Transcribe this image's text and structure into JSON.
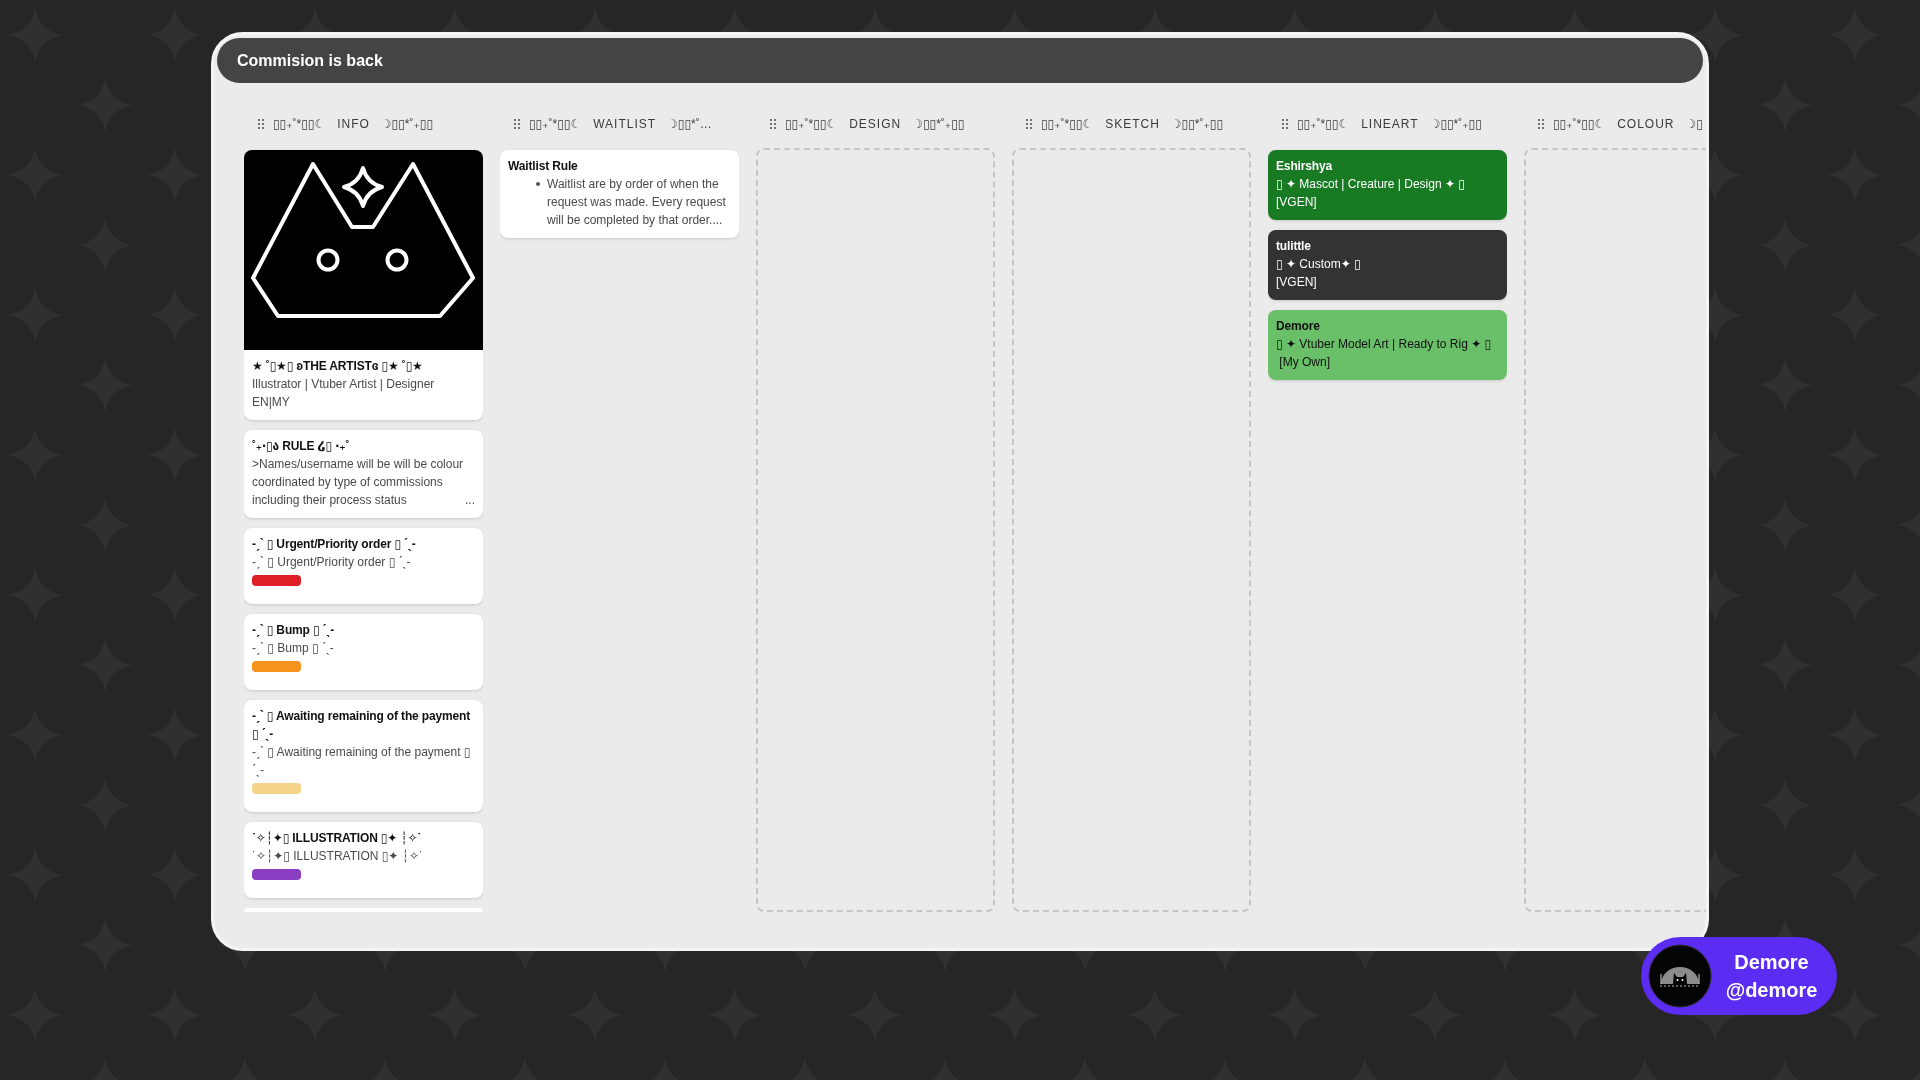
{
  "board": {
    "title": "Commision is back"
  },
  "columns": [
    {
      "deco_left": "▯▯₊˚*▯▯☾",
      "title": "INFO",
      "deco_right": "☽▯▯*˚₊▯▯",
      "cards": [
        {
          "kind": "cover",
          "title": "★ ˚▯★▯ ʚTHE ARTISTɞ ▯★ ˚▯★",
          "lines": [
            "Illustrator | Vtuber Artist | Designer",
            "EN|MY"
          ]
        },
        {
          "kind": "text",
          "title": "˚₊‧▯ა RULE ໒▯ ‧₊˚",
          "description": ">Names/username will be will be colour coordinated by type of commissions including their process status",
          "more": "..."
        },
        {
          "kind": "text",
          "title": "-ˏˋ ▯ Urgent/Priority order ▯ ˊˎ-",
          "description": "-ˏˋ ▯ Urgent/Priority order ▯ ˊˎ-",
          "label": {
            "color": "#de1f26"
          }
        },
        {
          "kind": "text",
          "title": "-ˏˋ ▯ Bump ▯ ˊˎ-",
          "description": "-ˏˋ ▯ Bump ▯ ˊˎ-",
          "label": {
            "color": "#f7941d"
          }
        },
        {
          "kind": "text",
          "title": "-ˏˋ ▯ Awaiting remaining of the payment ▯ ˊˎ-",
          "description": "-ˏˋ ▯ Awaiting remaining of the payment ▯ ˊˎ-",
          "label": {
            "color": "#f5d38b"
          }
        },
        {
          "kind": "text",
          "title": "˙✧┆✦▯ ILLUSTRATION ▯✦ ┆✧˙",
          "description": "˙✧┆✦▯ ILLUSTRATION ▯✦ ┆✧˙",
          "label": {
            "color": "#8b3ec1"
          }
        }
      ],
      "more_below": true
    },
    {
      "deco_left": "▯▯₊˚*▯▯☾",
      "title": "WAITLIST",
      "deco_right": "☽▯▯*˚…",
      "cards": [
        {
          "kind": "text",
          "title": "Waitlist Rule",
          "bullets": [
            "Waitlist are by order of when the request was made. Every request will be completed by that order...."
          ]
        }
      ]
    },
    {
      "deco_left": "▯▯₊˚*▯▯☾",
      "title": "DESIGN",
      "deco_right": "☽▯▯*˚₊▯▯"
    },
    {
      "deco_left": "▯▯₊˚*▯▯☾",
      "title": "SKETCH",
      "deco_right": "☽▯▯*˚₊▯▯"
    },
    {
      "deco_left": "▯▯₊˚*▯▯☾",
      "title": "LINEART",
      "deco_right": "☽▯▯*˚₊▯▯",
      "cards": [
        {
          "kind": "text",
          "title": "Eshirshya",
          "lines": [
            "▯ ✦ Mascot | Creature | Design ✦ ▯",
            "[VGEN]"
          ],
          "color": "#187a23"
        },
        {
          "kind": "text",
          "title": "tulittle",
          "lines": [
            "▯ ✦ Custom✦ ▯",
            "[VGEN]"
          ],
          "color": "#333333"
        },
        {
          "kind": "text",
          "title": "Demore",
          "lines": [
            "▯ ✦ Vtuber Model Art | Ready to Rig ✦ ▯",
            " [My Own]"
          ],
          "color": "#6abf69"
        }
      ]
    },
    {
      "deco_left": "▯▯₊˚*▯▯☾",
      "title": "COLOUR",
      "deco_right": "☽▯"
    }
  ],
  "profile": {
    "name": "Demore",
    "handle": "@demore"
  }
}
